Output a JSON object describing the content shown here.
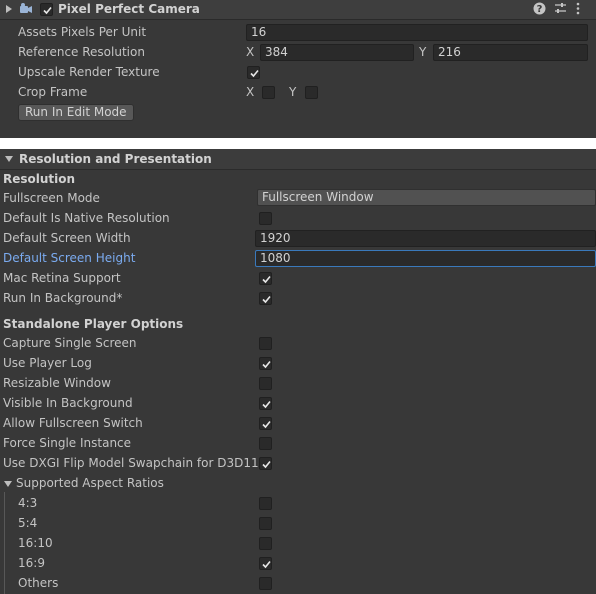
{
  "component": {
    "title": "Pixel Perfect Camera",
    "enabled": true,
    "icons": [
      "help-icon",
      "preset-icon",
      "menu-icon"
    ],
    "fields": {
      "assets_ppu": {
        "label": "Assets Pixels Per Unit",
        "value": "16"
      },
      "reference_resolution": {
        "label": "Reference Resolution",
        "x_label": "X",
        "x_value": "384",
        "y_label": "Y",
        "y_value": "216"
      },
      "upscale_rt": {
        "label": "Upscale Render Texture",
        "checked": true
      },
      "crop_frame": {
        "label": "Crop Frame",
        "x_label": "X",
        "x_checked": false,
        "y_label": "Y",
        "y_checked": false
      }
    },
    "run_button": "Run In Edit Mode"
  },
  "player": {
    "section_title": "Resolution and Presentation",
    "resolution_header": "Resolution",
    "fullscreen_mode": {
      "label": "Fullscreen Mode",
      "value": "Fullscreen Window"
    },
    "native_resolution": {
      "label": "Default Is Native Resolution",
      "checked": false
    },
    "screen_width": {
      "label": "Default Screen Width",
      "value": "1920"
    },
    "screen_height": {
      "label": "Default Screen Height",
      "value": "1080"
    },
    "retina": {
      "label": "Mac Retina Support",
      "checked": true
    },
    "run_background": {
      "label": "Run In Background*",
      "checked": true
    },
    "standalone_header": "Standalone Player Options",
    "capture_single": {
      "label": "Capture Single Screen",
      "checked": false
    },
    "player_log": {
      "label": "Use Player Log",
      "checked": true
    },
    "resizable": {
      "label": "Resizable Window",
      "checked": false
    },
    "visible_bg": {
      "label": "Visible In Background",
      "checked": true
    },
    "fullscreen_switch": {
      "label": "Allow Fullscreen Switch",
      "checked": true
    },
    "single_instance": {
      "label": "Force Single Instance",
      "checked": false
    },
    "dxgi": {
      "label": "Use DXGI Flip Model Swapchain for D3D11",
      "checked": true
    },
    "aspect_header": "Supported Aspect Ratios",
    "aspects": [
      {
        "label": "4:3",
        "checked": false
      },
      {
        "label": "5:4",
        "checked": false
      },
      {
        "label": "16:10",
        "checked": false
      },
      {
        "label": "16:9",
        "checked": true
      },
      {
        "label": "Others",
        "checked": false
      }
    ]
  }
}
